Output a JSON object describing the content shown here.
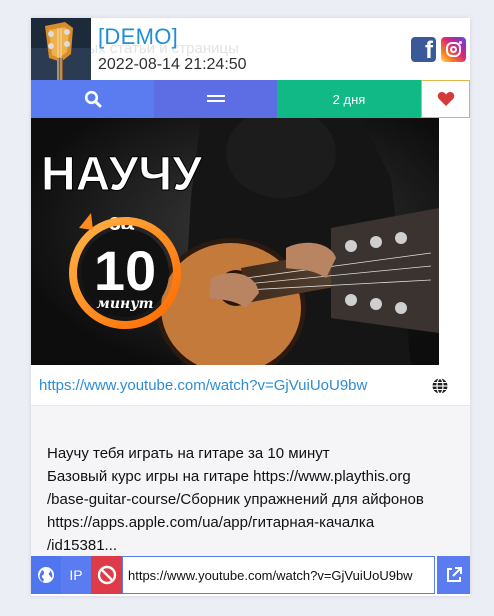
{
  "header": {
    "title": "[DEMO]",
    "datetime": "2022-08-14 21:24:50",
    "ghost_text": "Поиск новых статьи и страницы",
    "social": {
      "facebook": "facebook-icon",
      "instagram": "instagram-icon"
    }
  },
  "toolbar": {
    "search_icon": "search-icon",
    "menu_icon": "menu-icon",
    "age_label": "2 дня",
    "favorite_icon": "heart-icon"
  },
  "thumbnail": {
    "overlay_title": "НАУЧУ",
    "overlay_za": "за",
    "overlay_number": "10",
    "overlay_minutes": "минут"
  },
  "link": {
    "url": "https://www.youtube.com/watch?v=GjVuiUoU9bw",
    "icon": "globe-icon"
  },
  "description": {
    "lines": [
      "Научу тебя играть на гитаре за 10 минут",
      "Базовый курс игры на гитаре https://www.playthis.org",
      "/base-guitar-course/Сборник упражнений для айфонов",
      "https://apps.apple.com/ua/app/гитарная-качалка",
      "/id15381..."
    ]
  },
  "bottom": {
    "ip_label": "IP",
    "url_value": "https://www.youtube.com/watch?v=GjVuiUoU9bw",
    "globe_icon": "globe-icon",
    "block_icon": "ban-icon",
    "open_icon": "external-link-icon"
  },
  "colors": {
    "accent_blue": "#5a7cf0",
    "menu_blue": "#5d6de3",
    "green": "#10b985",
    "red": "#dd3b48",
    "link": "#2f8cd3",
    "heart": "#d43a3a"
  }
}
